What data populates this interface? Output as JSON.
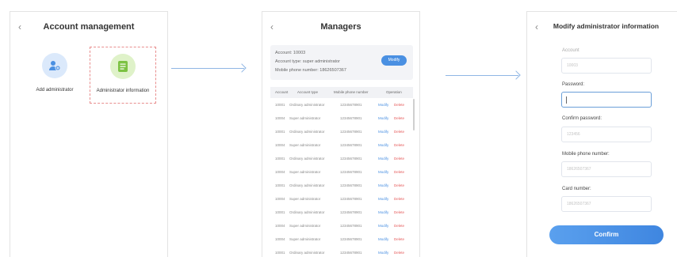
{
  "colors": {
    "primary_blue": "#4a90e2",
    "delete_red": "#e55a5a",
    "arrow": "#8fb6e4",
    "dashed_highlight": "#e88d8d"
  },
  "screen1": {
    "title": "Account management",
    "back_icon": "chevron-left-icon",
    "tiles": [
      {
        "label": "Add administrator",
        "icon": "user-add-icon"
      },
      {
        "label": "Administrator information",
        "icon": "document-icon"
      }
    ]
  },
  "screen2": {
    "title": "Managers",
    "info": {
      "account": "Account: 10003",
      "account_type": "Account type: super administrator",
      "mobile": "Mobile phone number: 18626507367",
      "modify_label": "Modify"
    },
    "columns": [
      "Account",
      "Account type",
      "Mobile phone number",
      "Operation"
    ],
    "rows": [
      {
        "account": "10001",
        "type": "Ordinary administrator",
        "mobile": "12345678901",
        "modify": "Modify",
        "delete": "Delete"
      },
      {
        "account": "10004",
        "type": "Super administrator",
        "mobile": "12345678901",
        "modify": "Modify",
        "delete": "Delete"
      },
      {
        "account": "10001",
        "type": "Ordinary administrator",
        "mobile": "12345678901",
        "modify": "Modify",
        "delete": "Delete"
      },
      {
        "account": "10004",
        "type": "Super administrator",
        "mobile": "12345678901",
        "modify": "Modify",
        "delete": "Delete"
      },
      {
        "account": "10001",
        "type": "Ordinary administrator",
        "mobile": "12345678901",
        "modify": "Modify",
        "delete": "Delete"
      },
      {
        "account": "10004",
        "type": "Super administrator",
        "mobile": "12345678901",
        "modify": "Modify",
        "delete": "Delete"
      },
      {
        "account": "10001",
        "type": "Ordinary administrator",
        "mobile": "12345678901",
        "modify": "Modify",
        "delete": "Delete"
      },
      {
        "account": "10004",
        "type": "Super administrator",
        "mobile": "12345678901",
        "modify": "Modify",
        "delete": "Delete"
      },
      {
        "account": "10001",
        "type": "Ordinary administrator",
        "mobile": "12345678901",
        "modify": "Modify",
        "delete": "Delete"
      },
      {
        "account": "10004",
        "type": "Super administrator",
        "mobile": "12345678901",
        "modify": "Modify",
        "delete": "Delete"
      },
      {
        "account": "10004",
        "type": "Super administrator",
        "mobile": "12345678901",
        "modify": "Modify",
        "delete": "Delete"
      },
      {
        "account": "10001",
        "type": "Ordinary administrator",
        "mobile": "12345678901",
        "modify": "Modify",
        "delete": "Delete"
      }
    ]
  },
  "screen3": {
    "title": "Modify administrator information",
    "fields": {
      "account": {
        "label": "Account",
        "placeholder": "10003"
      },
      "password": {
        "label": "Password:",
        "placeholder": ""
      },
      "confirm_password": {
        "label": "Confirm password:",
        "placeholder": "123456"
      },
      "mobile": {
        "label": "Mobile phone number:",
        "placeholder": "18626507367"
      },
      "card": {
        "label": "Card number:",
        "placeholder": "18626507367"
      }
    },
    "confirm_label": "Confirm"
  }
}
